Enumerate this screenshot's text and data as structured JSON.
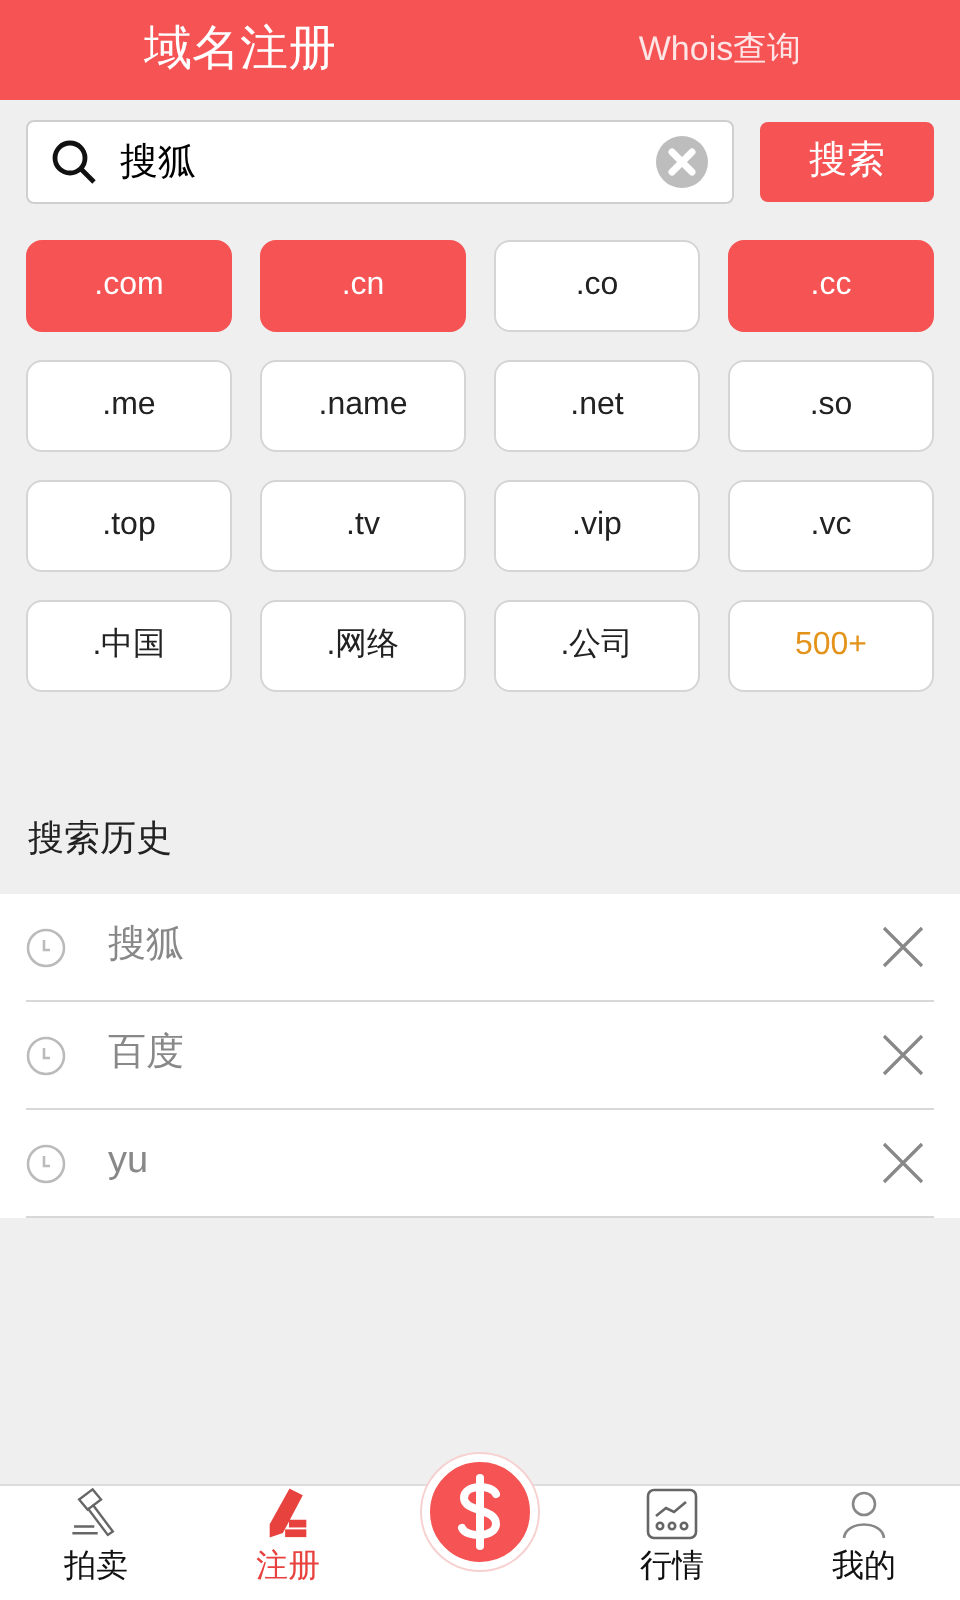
{
  "header_tabs": [
    {
      "label": "域名注册",
      "selected": true
    },
    {
      "label": "Whois查询",
      "selected": false
    }
  ],
  "search": {
    "value": "搜狐",
    "button": "搜索"
  },
  "suffixes": [
    {
      "label": ".com",
      "selected": true,
      "kind": "suffix"
    },
    {
      "label": ".cn",
      "selected": true,
      "kind": "suffix"
    },
    {
      "label": ".co",
      "selected": false,
      "kind": "suffix"
    },
    {
      "label": ".cc",
      "selected": true,
      "kind": "suffix"
    },
    {
      "label": ".me",
      "selected": false,
      "kind": "suffix"
    },
    {
      "label": ".name",
      "selected": false,
      "kind": "suffix"
    },
    {
      "label": ".net",
      "selected": false,
      "kind": "suffix"
    },
    {
      "label": ".so",
      "selected": false,
      "kind": "suffix"
    },
    {
      "label": ".top",
      "selected": false,
      "kind": "suffix"
    },
    {
      "label": ".tv",
      "selected": false,
      "kind": "suffix"
    },
    {
      "label": ".vip",
      "selected": false,
      "kind": "suffix"
    },
    {
      "label": ".vc",
      "selected": false,
      "kind": "suffix"
    },
    {
      "label": ".中国",
      "selected": false,
      "kind": "suffix"
    },
    {
      "label": ".网络",
      "selected": false,
      "kind": "suffix"
    },
    {
      "label": ".公司",
      "selected": false,
      "kind": "suffix"
    },
    {
      "label": "500+",
      "kind": "more"
    }
  ],
  "history": {
    "title": "搜索历史",
    "items": [
      "搜狐",
      "百度",
      "yu"
    ]
  },
  "bottom_nav": [
    {
      "label": "拍卖",
      "kind": "tab",
      "selected": false
    },
    {
      "label": "注册",
      "kind": "tab",
      "selected": true
    },
    {
      "kind": "center"
    },
    {
      "label": "行情",
      "kind": "tab",
      "selected": false
    },
    {
      "label": "我的",
      "kind": "tab",
      "selected": false
    }
  ]
}
